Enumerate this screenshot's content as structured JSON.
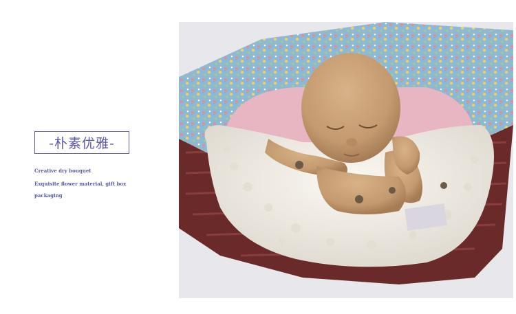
{
  "heading": "-朴素优雅-",
  "descriptions": [
    "Creative dry bouquet",
    "Exquisite flower material, gift box",
    "packaging"
  ],
  "photo": {
    "colors": {
      "background": "#e7e7ec",
      "basket": "#6a2a2a",
      "floral_blanket": "#8fb9d2",
      "pink_pillow": "#e7b6c2",
      "fleece": "#f1ede6",
      "skin": "#c49a70"
    }
  }
}
